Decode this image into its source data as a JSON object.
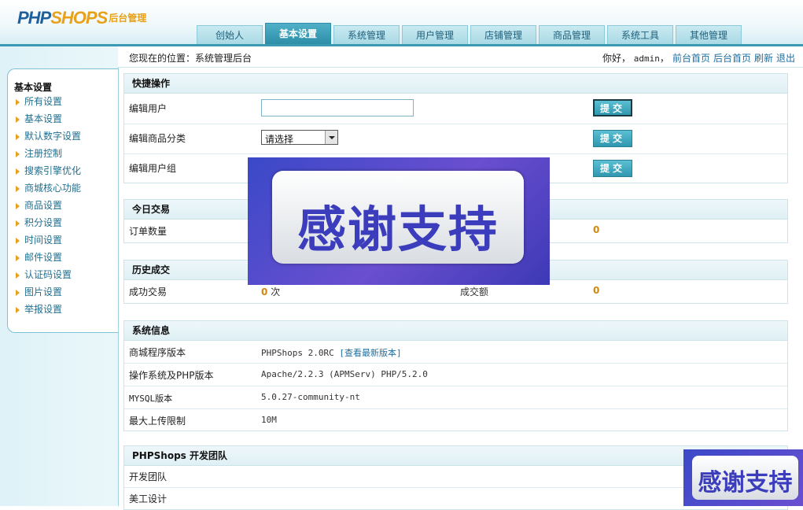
{
  "logo": {
    "php": "PHP",
    "shops": "SHOPS",
    "admin": "后台管理"
  },
  "nav": {
    "tabs": [
      "创始人",
      "基本设置",
      "系统管理",
      "用户管理",
      "店铺管理",
      "商品管理",
      "系统工具",
      "其他管理"
    ],
    "active": "基本设置"
  },
  "sidebar": {
    "title": "基本设置",
    "items": [
      "所有设置",
      "基本设置",
      "默认数字设置",
      "注册控制",
      "搜索引擎优化",
      "商城核心功能",
      "商品设置",
      "积分设置",
      "时间设置",
      "邮件设置",
      "认证码设置",
      "图片设置",
      "举报设置"
    ]
  },
  "topbar": {
    "location": "您现在的位置：系统管理后台",
    "greeting": "你好，",
    "username": "admin",
    "sep": "，",
    "links": [
      "前台首页",
      "后台首页",
      "刷新",
      "退出"
    ]
  },
  "quick": {
    "title": "快捷操作",
    "rows": [
      {
        "label": "编辑用户",
        "button": "提交"
      },
      {
        "label": "编辑商品分类",
        "select": "请选择",
        "button": "提交"
      },
      {
        "label": "编辑用户组",
        "button": "提交"
      }
    ]
  },
  "today": {
    "title": "今日交易",
    "label": "订单数量",
    "value": "0"
  },
  "history": {
    "title": "历史成交",
    "label": "成功交易",
    "count": "0",
    "unit": "次",
    "amount_label": "成交额",
    "amount": "0"
  },
  "sysinfo": {
    "title": "系统信息",
    "rows": [
      {
        "label": "商城程序版本",
        "value": "PHPShops 2.0RC",
        "link": "[查看最新版本]"
      },
      {
        "label": "操作系统及PHP版本",
        "value": "Apache/2.2.3 (APMServ) PHP/5.2.0"
      },
      {
        "label": "MYSQL版本",
        "value": "5.0.27-community-nt"
      },
      {
        "label": "最大上传限制",
        "value": "10M"
      }
    ]
  },
  "team": {
    "title": "PHPShops 开发团队",
    "rows": [
      "开发团队",
      "美工设计"
    ]
  },
  "overlay": {
    "text": "感谢支持"
  },
  "colors": {
    "accent": "#2e8ea8",
    "link": "#1f6f9f",
    "orange": "#d2870e",
    "overlay": "#3b3dbd"
  }
}
